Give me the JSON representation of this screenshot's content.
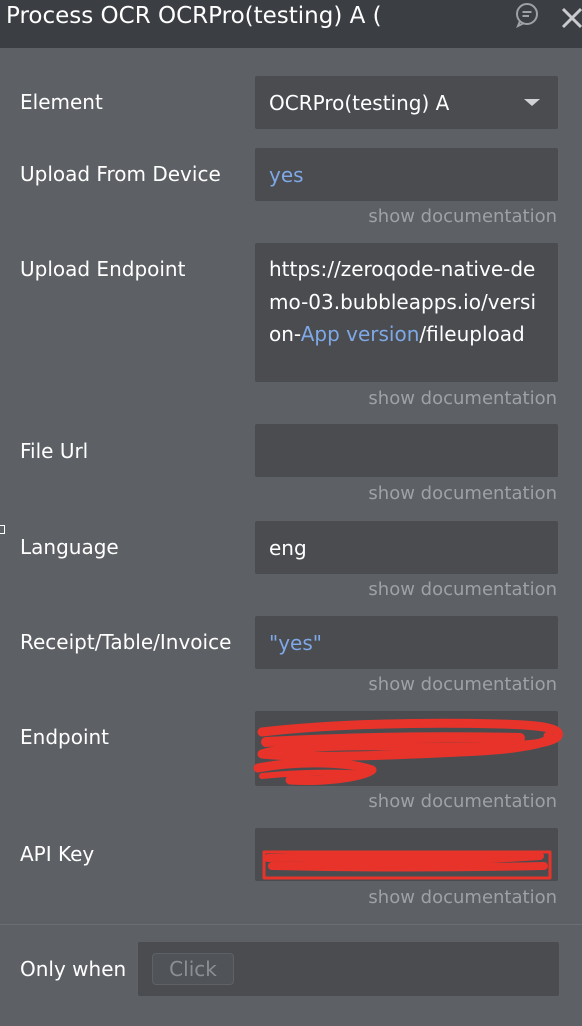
{
  "header": {
    "title": "Process OCR OCRPro(testing) A (",
    "comment_icon": "comment-icon",
    "close_icon": "close-icon"
  },
  "rows": {
    "element": {
      "label": "Element",
      "value": "OCRPro(testing) A"
    },
    "upload_from_device": {
      "label": "Upload From Device",
      "value": "yes",
      "doc": "show documentation"
    },
    "upload_endpoint": {
      "label": "Upload Endpoint",
      "text_before": "https://zeroqode-native-demo-03.bubbleapps.io/version-",
      "dynamic": "App version",
      "text_after": "/fileupload",
      "doc": "show documentation"
    },
    "file_url": {
      "label": "File Url",
      "value": "",
      "doc": "show documentation"
    },
    "language": {
      "label": "Language",
      "value": "eng",
      "doc": "show documentation"
    },
    "receipt": {
      "label": "Receipt/Table/Invoice",
      "value": "\"yes\"",
      "doc": "show documentation"
    },
    "endpoint": {
      "label": "Endpoint",
      "value": "",
      "doc": "show documentation"
    },
    "api_key": {
      "label": "API Key",
      "value": "",
      "doc": "show documentation"
    }
  },
  "only_when": {
    "label": "Only when",
    "placeholder": "Click"
  },
  "colors": {
    "panel": "#5d6064",
    "header": "#3b3e43",
    "field": "#4a4c50",
    "dynamic_text": "#7fa8e6",
    "doc_text": "#9ea1a6",
    "redaction": "#e8332a"
  }
}
